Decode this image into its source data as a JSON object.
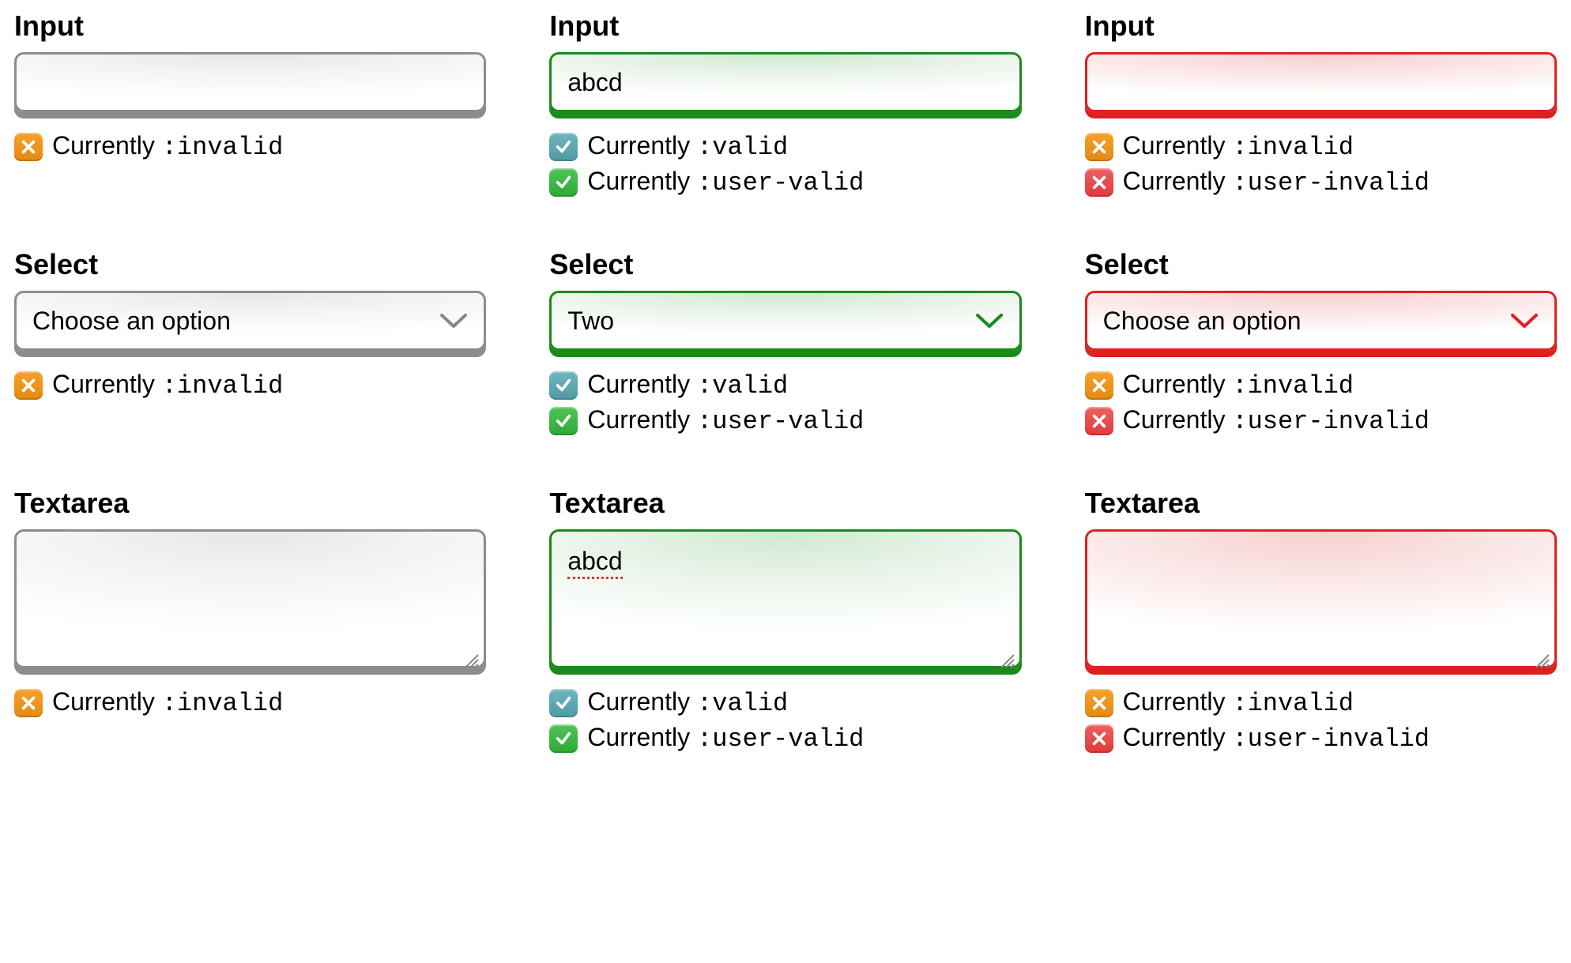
{
  "labels": {
    "input": "Input",
    "select": "Select",
    "textarea": "Textarea"
  },
  "status_prefix": "Currently ",
  "selectors": {
    "invalid": ":invalid",
    "valid": ":valid",
    "user_valid": ":user-valid",
    "user_invalid": ":user-invalid"
  },
  "icons": {
    "x": "x-icon",
    "check": "check-icon"
  },
  "colors": {
    "gray": "#8c8c8c",
    "green": "#1a8a1a",
    "red": "#e02020",
    "badge_orange": "#e38a12",
    "badge_teal": "#4f9aa3",
    "badge_green": "#2faa36",
    "badge_red": "#e03a3a"
  },
  "cells": {
    "input_col1": {
      "value": "",
      "statuses": [
        {
          "badge": "orange",
          "icon": "x",
          "selector_key": "invalid"
        }
      ]
    },
    "input_col2": {
      "value": "abcd",
      "statuses": [
        {
          "badge": "teal",
          "icon": "check",
          "selector_key": "valid"
        },
        {
          "badge": "green",
          "icon": "check",
          "selector_key": "user_valid"
        }
      ]
    },
    "input_col3": {
      "value": "",
      "statuses": [
        {
          "badge": "orange",
          "icon": "x",
          "selector_key": "invalid"
        },
        {
          "badge": "red",
          "icon": "x",
          "selector_key": "user_invalid"
        }
      ]
    },
    "select_col1": {
      "value": "Choose an option",
      "statuses": [
        {
          "badge": "orange",
          "icon": "x",
          "selector_key": "invalid"
        }
      ]
    },
    "select_col2": {
      "value": "Two",
      "statuses": [
        {
          "badge": "teal",
          "icon": "check",
          "selector_key": "valid"
        },
        {
          "badge": "green",
          "icon": "check",
          "selector_key": "user_valid"
        }
      ]
    },
    "select_col3": {
      "value": "Choose an option",
      "statuses": [
        {
          "badge": "orange",
          "icon": "x",
          "selector_key": "invalid"
        },
        {
          "badge": "red",
          "icon": "x",
          "selector_key": "user_invalid"
        }
      ]
    },
    "textarea_col1": {
      "value": "",
      "statuses": [
        {
          "badge": "orange",
          "icon": "x",
          "selector_key": "invalid"
        }
      ]
    },
    "textarea_col2": {
      "value": "abcd",
      "statuses": [
        {
          "badge": "teal",
          "icon": "check",
          "selector_key": "valid"
        },
        {
          "badge": "green",
          "icon": "check",
          "selector_key": "user_valid"
        }
      ]
    },
    "textarea_col3": {
      "value": "",
      "statuses": [
        {
          "badge": "orange",
          "icon": "x",
          "selector_key": "invalid"
        },
        {
          "badge": "red",
          "icon": "x",
          "selector_key": "user_invalid"
        }
      ]
    }
  }
}
